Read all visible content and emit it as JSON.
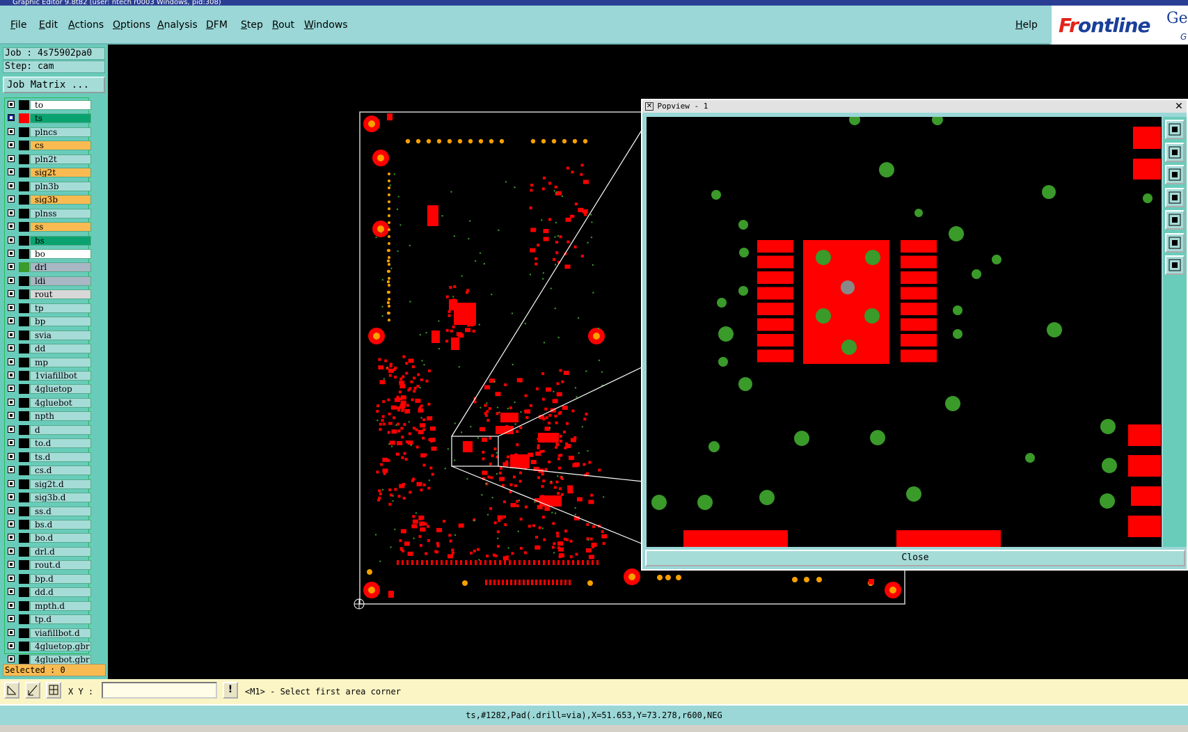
{
  "window": {
    "title": "Graphic Editor 9.8t82 (user: ntech r0003  Windows, pid:308)"
  },
  "menu": {
    "items": [
      "File",
      "Edit",
      "Actions",
      "Options",
      "Analysis",
      "DFM",
      "Step",
      "Rout",
      "Windows"
    ],
    "help": "Help"
  },
  "logo": {
    "brand_red": "Fr",
    "brand_blue": "ontline",
    "ge": "Ge",
    "g2": "G"
  },
  "job": {
    "job_line": "Job : 4s75902pa0",
    "step_line": "Step: cam",
    "matrix_button": "Job Matrix ..."
  },
  "layers": [
    {
      "name": "to",
      "color": "#ffffff",
      "swatch": "#000000",
      "sel": false
    },
    {
      "name": "ts",
      "color": "#0aa36f",
      "swatch": "#ff0000",
      "sel": true
    },
    {
      "name": "plncs",
      "color": "#a6dcd8",
      "swatch": "#000000",
      "sel": false
    },
    {
      "name": "cs",
      "color": "#f9bb51",
      "swatch": "#000000",
      "sel": false
    },
    {
      "name": "pln2t",
      "color": "#a6dcd8",
      "swatch": "#000000",
      "sel": false
    },
    {
      "name": "sig2t",
      "color": "#f9bb51",
      "swatch": "#000000",
      "sel": false
    },
    {
      "name": "pln3b",
      "color": "#a6dcd8",
      "swatch": "#000000",
      "sel": false
    },
    {
      "name": "sig3b",
      "color": "#f9bb51",
      "swatch": "#000000",
      "sel": false
    },
    {
      "name": "plnss",
      "color": "#a6dcd8",
      "swatch": "#000000",
      "sel": false
    },
    {
      "name": "ss",
      "color": "#f9bb51",
      "swatch": "#000000",
      "sel": false
    },
    {
      "name": "bs",
      "color": "#0aa36f",
      "swatch": "#000000",
      "sel": false
    },
    {
      "name": "bo",
      "color": "#ffffff",
      "swatch": "#000000",
      "sel": false
    },
    {
      "name": "drl",
      "color": "#a9b6c4",
      "swatch": "#3a9a2a",
      "sel": false
    },
    {
      "name": "ldi",
      "color": "#a9b6c4",
      "swatch": "#000000",
      "sel": false
    },
    {
      "name": "rout",
      "color": "#d8d8d8",
      "swatch": "#000000",
      "sel": false
    },
    {
      "name": "tp",
      "color": "#a6dcd8",
      "swatch": "#000000",
      "sel": false
    },
    {
      "name": "bp",
      "color": "#a6dcd8",
      "swatch": "#000000",
      "sel": false
    },
    {
      "name": "svia",
      "color": "#a6dcd8",
      "swatch": "#000000",
      "sel": false
    },
    {
      "name": "dd",
      "color": "#a6dcd8",
      "swatch": "#000000",
      "sel": false
    },
    {
      "name": "mp",
      "color": "#a6dcd8",
      "swatch": "#000000",
      "sel": false
    },
    {
      "name": "1viafillbot",
      "color": "#a6dcd8",
      "swatch": "#000000",
      "sel": false
    },
    {
      "name": "4gluetop",
      "color": "#a6dcd8",
      "swatch": "#000000",
      "sel": false
    },
    {
      "name": "4gluebot",
      "color": "#a6dcd8",
      "swatch": "#000000",
      "sel": false
    },
    {
      "name": "npth",
      "color": "#a6dcd8",
      "swatch": "#000000",
      "sel": false
    },
    {
      "name": "d",
      "color": "#a6dcd8",
      "swatch": "#000000",
      "sel": false
    },
    {
      "name": "to.d",
      "color": "#a6dcd8",
      "swatch": "#000000",
      "sel": false
    },
    {
      "name": "ts.d",
      "color": "#a6dcd8",
      "swatch": "#000000",
      "sel": false
    },
    {
      "name": "cs.d",
      "color": "#a6dcd8",
      "swatch": "#000000",
      "sel": false
    },
    {
      "name": "sig2t.d",
      "color": "#a6dcd8",
      "swatch": "#000000",
      "sel": false
    },
    {
      "name": "sig3b.d",
      "color": "#a6dcd8",
      "swatch": "#000000",
      "sel": false
    },
    {
      "name": "ss.d",
      "color": "#a6dcd8",
      "swatch": "#000000",
      "sel": false
    },
    {
      "name": "bs.d",
      "color": "#a6dcd8",
      "swatch": "#000000",
      "sel": false
    },
    {
      "name": "bo.d",
      "color": "#a6dcd8",
      "swatch": "#000000",
      "sel": false
    },
    {
      "name": "drl.d",
      "color": "#a6dcd8",
      "swatch": "#000000",
      "sel": false
    },
    {
      "name": "rout.d",
      "color": "#a6dcd8",
      "swatch": "#000000",
      "sel": false
    },
    {
      "name": "bp.d",
      "color": "#a6dcd8",
      "swatch": "#000000",
      "sel": false
    },
    {
      "name": "dd.d",
      "color": "#a6dcd8",
      "swatch": "#000000",
      "sel": false
    },
    {
      "name": "mpth.d",
      "color": "#a6dcd8",
      "swatch": "#000000",
      "sel": false
    },
    {
      "name": "tp.d",
      "color": "#a6dcd8",
      "swatch": "#000000",
      "sel": false
    },
    {
      "name": "viafillbot.d",
      "color": "#a6dcd8",
      "swatch": "#000000",
      "sel": false
    },
    {
      "name": "4gluetop.gbr",
      "color": "#a6dcd8",
      "swatch": "#000000",
      "sel": false
    },
    {
      "name": "4gluebot.gbr",
      "color": "#a6dcd8",
      "swatch": "#000000",
      "sel": false
    }
  ],
  "selected": "Selected : 0",
  "command": {
    "xy_label": "X Y :",
    "xy_value": "",
    "excl": "!",
    "prompt": "<M1> - Select first area corner"
  },
  "status": "ts,#1282,Pad(.drill=via),X=51.653,Y=73.278,r600,NEG",
  "popview": {
    "title": "Popview - 1",
    "close_label": "Close",
    "tools": [
      "zoom-fit-icon",
      "pan-up-icon",
      "pan-down-icon",
      "pan-left-icon",
      "pan-right-icon",
      "zoom-in-icon",
      "zoom-out-icon"
    ]
  },
  "colors": {
    "pad": "#ff0000",
    "pad_ring": "#f9a000",
    "drill": "#3a9a2a",
    "accent": "#9ad7d6"
  }
}
